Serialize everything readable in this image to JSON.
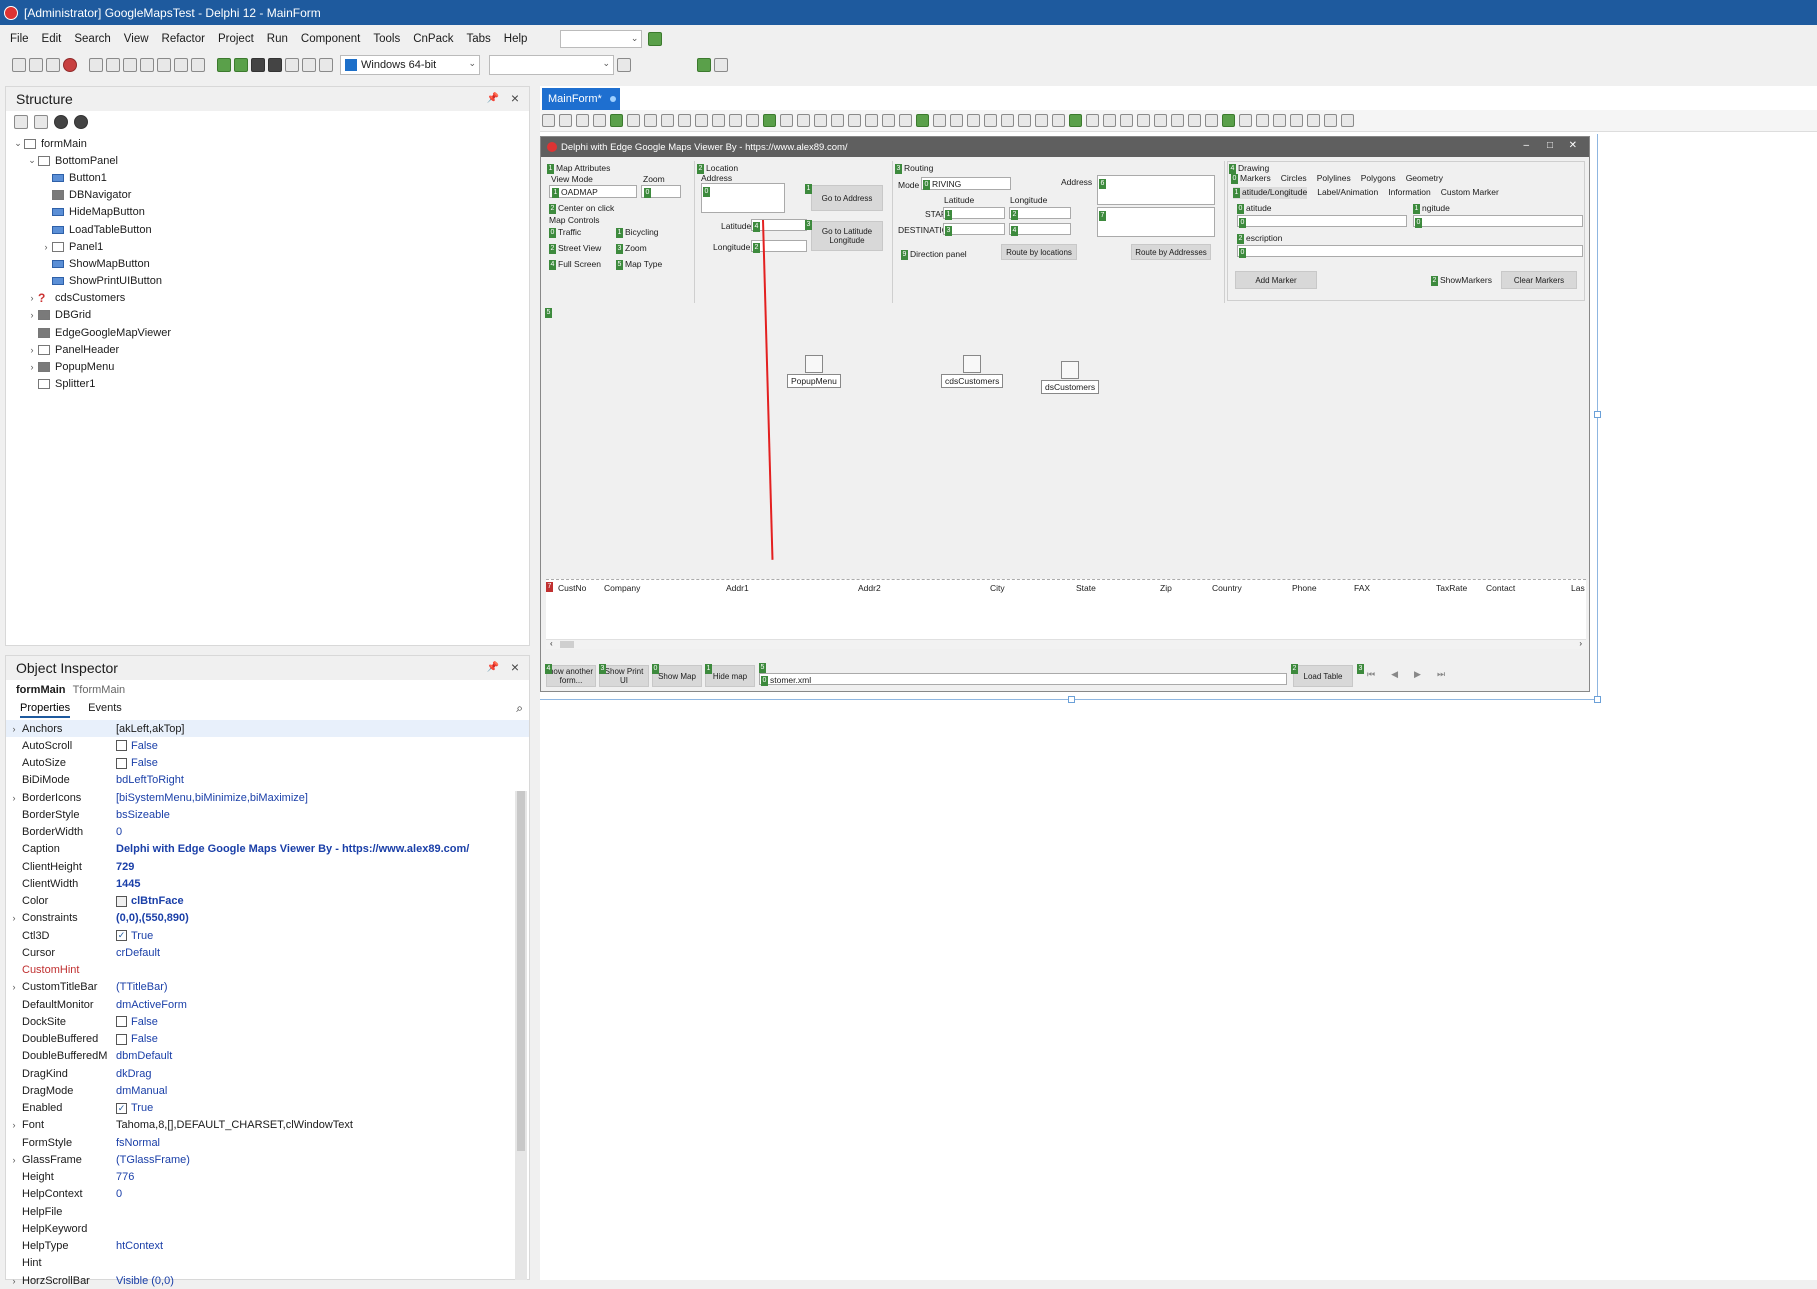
{
  "window": {
    "title": "[Administrator] GoogleMapsTest - Delphi 12 - MainForm"
  },
  "menu": [
    "File",
    "Edit",
    "Search",
    "View",
    "Refactor",
    "Project",
    "Run",
    "Component",
    "Tools",
    "CnPack",
    "Tabs",
    "Help"
  ],
  "toolbar": {
    "platform": "Windows 64-bit"
  },
  "structure": {
    "title": "Structure",
    "nodes": [
      {
        "label": "formMain",
        "level": 0,
        "exp": "⌄",
        "icon": "form"
      },
      {
        "label": "BottomPanel",
        "level": 1,
        "exp": "⌄",
        "icon": "panel"
      },
      {
        "label": "Button1",
        "level": 2,
        "exp": "",
        "icon": "btn"
      },
      {
        "label": "DBNavigator",
        "level": 2,
        "exp": "",
        "icon": "db"
      },
      {
        "label": "HideMapButton",
        "level": 2,
        "exp": "",
        "icon": "btn"
      },
      {
        "label": "LoadTableButton",
        "level": 2,
        "exp": "",
        "icon": "btn"
      },
      {
        "label": "Panel1",
        "level": 2,
        "exp": "›",
        "icon": "panel"
      },
      {
        "label": "ShowMapButton",
        "level": 2,
        "exp": "",
        "icon": "btn"
      },
      {
        "label": "ShowPrintUIButton",
        "level": 2,
        "exp": "",
        "icon": "btn"
      },
      {
        "label": "cdsCustomers",
        "level": 1,
        "exp": "›",
        "icon": "q"
      },
      {
        "label": "DBGrid",
        "level": 1,
        "exp": "›",
        "icon": "db"
      },
      {
        "label": "EdgeGoogleMapViewer",
        "level": 1,
        "exp": "",
        "icon": "db"
      },
      {
        "label": "PanelHeader",
        "level": 1,
        "exp": "›",
        "icon": "panel"
      },
      {
        "label": "PopupMenu",
        "level": 1,
        "exp": "›",
        "icon": "db"
      },
      {
        "label": "Splitter1",
        "level": 1,
        "exp": "",
        "icon": "panel"
      }
    ]
  },
  "inspector": {
    "title": "Object Inspector",
    "object": "formMain",
    "class": "TformMain",
    "tabs": [
      "Properties",
      "Events"
    ],
    "props": [
      {
        "name": "Anchors",
        "value": "[akLeft,akTop]",
        "exp": "›",
        "style": "plain"
      },
      {
        "name": "AutoScroll",
        "value": "False",
        "chk": "off"
      },
      {
        "name": "AutoSize",
        "value": "False",
        "chk": "off"
      },
      {
        "name": "BiDiMode",
        "value": "bdLeftToRight"
      },
      {
        "name": "BorderIcons",
        "value": "[biSystemMenu,biMinimize,biMaximize]",
        "exp": "›"
      },
      {
        "name": "BorderStyle",
        "value": "bsSizeable"
      },
      {
        "name": "BorderWidth",
        "value": "0"
      },
      {
        "name": "Caption",
        "value": "Delphi with Edge Google Maps Viewer By - https://www.alex89.com/",
        "style": "bold"
      },
      {
        "name": "ClientHeight",
        "value": "729",
        "style": "bold"
      },
      {
        "name": "ClientWidth",
        "value": "1445",
        "style": "bold"
      },
      {
        "name": "Color",
        "value": "clBtnFace",
        "style": "bold",
        "color": true
      },
      {
        "name": "Constraints",
        "value": "(0,0),(550,890)",
        "exp": "›",
        "style": "bold"
      },
      {
        "name": "Ctl3D",
        "value": "True",
        "chk": "on"
      },
      {
        "name": "Cursor",
        "value": "crDefault"
      },
      {
        "name": "CustomHint",
        "value": "",
        "red": true
      },
      {
        "name": "CustomTitleBar",
        "value": "(TTitleBar)",
        "exp": "›"
      },
      {
        "name": "DefaultMonitor",
        "value": "dmActiveForm"
      },
      {
        "name": "DockSite",
        "value": "False",
        "chk": "off"
      },
      {
        "name": "DoubleBuffered",
        "value": "False",
        "chk": "off"
      },
      {
        "name": "DoubleBufferedM",
        "value": "dbmDefault"
      },
      {
        "name": "DragKind",
        "value": "dkDrag"
      },
      {
        "name": "DragMode",
        "value": "dmManual"
      },
      {
        "name": "Enabled",
        "value": "True",
        "chk": "on"
      },
      {
        "name": "Font",
        "value": "Tahoma,8,[],DEFAULT_CHARSET,clWindowText",
        "exp": "›",
        "style": "plain"
      },
      {
        "name": "FormStyle",
        "value": "fsNormal"
      },
      {
        "name": "GlassFrame",
        "value": "(TGlassFrame)",
        "exp": "›"
      },
      {
        "name": "Height",
        "value": "776"
      },
      {
        "name": "HelpContext",
        "value": "0"
      },
      {
        "name": "HelpFile",
        "value": ""
      },
      {
        "name": "HelpKeyword",
        "value": ""
      },
      {
        "name": "HelpType",
        "value": "htContext"
      },
      {
        "name": "Hint",
        "value": ""
      },
      {
        "name": "HorzScrollBar",
        "value": "Visible (0,0)",
        "exp": "›"
      }
    ]
  },
  "designer": {
    "tab": "MainForm*",
    "form_caption": "Delphi with Edge Google Maps Viewer By - https://www.alex89.com/",
    "map_attr": {
      "title": "Map Attributes",
      "view_mode": "View Mode",
      "zoom": "Zoom",
      "view_value": "OADMAP",
      "zoom_value": "0",
      "center": "Center on click",
      "controls": "Map Controls",
      "traffic": "Traffic",
      "bicycling": "Bicycling",
      "street": "Street View",
      "zoomc": "Zoom",
      "full": "Full Screen",
      "maptype": "Map Type"
    },
    "location": {
      "title": "Location",
      "address": "Address",
      "latitude": "Latitude",
      "longitude": "Longitude",
      "go_address": "Go to Address",
      "go_latlng": "Go to Latitude Longitude"
    },
    "routing": {
      "title": "Routing",
      "mode": "Mode",
      "mode_value": "RIVING",
      "address": "Address",
      "latitude": "Latitude",
      "longitude": "Longitude",
      "start": "START",
      "destination": "DESTINATION",
      "direction": "Direction panel",
      "route_loc": "Route by locations",
      "route_addr": "Route by Addresses"
    },
    "drawing": {
      "title": "Drawing",
      "tabs": [
        "Markers",
        "Circles",
        "Polylines",
        "Polygons",
        "Geometry"
      ],
      "subtabs": [
        "atitude/Longitude",
        "Label/Animation",
        "Information",
        "Custom Marker"
      ],
      "lat": "atitude",
      "lng": "ngitude",
      "desc": "escription",
      "add": "Add Marker",
      "show": "ShowMarkers",
      "clear": "Clear Markers"
    },
    "components": [
      "PopupMenu",
      "cdsCustomers",
      "dsCustomers"
    ],
    "grid_cols": [
      "CustNo",
      "Company",
      "Addr1",
      "Addr2",
      "City",
      "State",
      "Zip",
      "Country",
      "Phone",
      "FAX",
      "TaxRate",
      "Contact",
      "Las"
    ],
    "bottom": {
      "show_another": "how another form...",
      "show_print": "Show Print UI",
      "show_map": "Show Map",
      "hide_map": "Hide map",
      "file": "stomer.xml",
      "load": "Load Table"
    }
  }
}
